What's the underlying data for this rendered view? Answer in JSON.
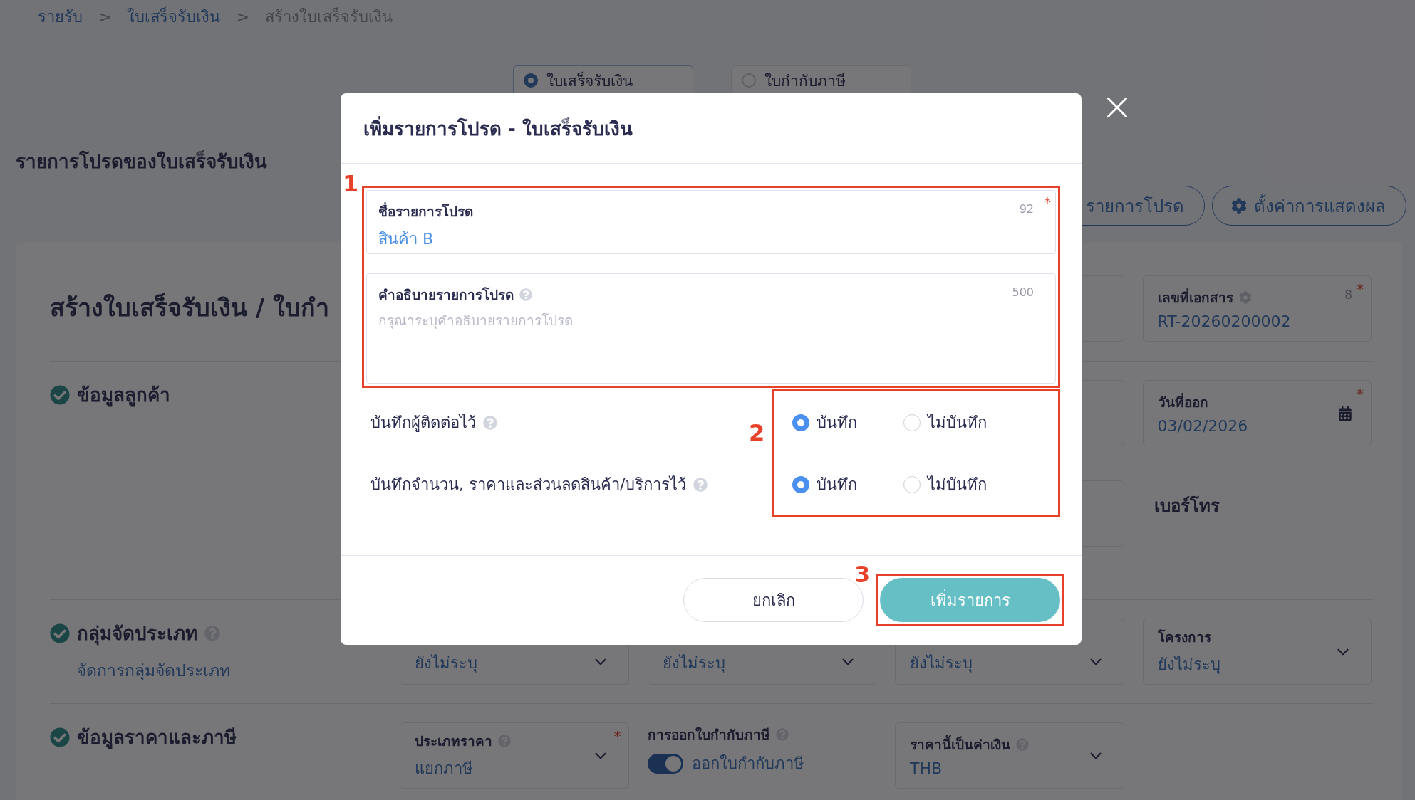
{
  "breadcrumb": [
    {
      "label": "รายรับ",
      "current": false
    },
    {
      "separator": ">",
      "label": "ใบเสร็จรับเงิน",
      "current": false
    },
    {
      "separator": ">",
      "label": "สร้างใบเสร็จรับเงิน",
      "current": true
    }
  ],
  "document_tabs": [
    {
      "label": "ใบเสร็จรับเงิน",
      "selected": true
    },
    {
      "label": "ใบกำกับภาษี",
      "selected": false
    }
  ],
  "favorites_title": "รายการโปรดของใบเสร็จรับเงิน",
  "toolbar_buttons": [
    {
      "kind": "plain",
      "label": "รายการโปรด"
    },
    {
      "kind": "gear",
      "label": "ตั้งค่าการแสดงผล"
    }
  ],
  "form": {
    "title": "สร้างใบเสร็จรับเงิน / ใบกำ",
    "header_fields": [
      {
        "kind": "blank"
      },
      {
        "kind": "text",
        "label": "เลขที่เอกสาร",
        "settings_icon": true,
        "counter": "8",
        "required": "*",
        "value": "RT-20260200002"
      }
    ],
    "sections": [
      {
        "title": "ข้อมูลลูกค้า",
        "done": true,
        "fields": [
          {
            "kind": "blank"
          },
          {
            "kind": "blank"
          },
          {
            "kind": "blank"
          },
          {
            "kind": "date",
            "label": "วันที่ออก",
            "required": "*",
            "value": "03/02/2026"
          },
          {
            "kind": "blank"
          },
          {
            "kind": "blank"
          },
          {
            "kind": "blank"
          },
          {
            "kind": "heading",
            "label": "เบอร์โทร"
          }
        ]
      },
      {
        "title": "กลุ่มจัดประเภท",
        "done": true,
        "help": true,
        "link": "จัดการกลุ่มจัดประเภท",
        "fields": [
          {
            "kind": "select",
            "value": "ยังไม่ระบุ"
          },
          {
            "kind": "select",
            "value": "ยังไม่ระบุ"
          },
          {
            "kind": "select",
            "value": "ยังไม่ระบุ"
          },
          {
            "kind": "select",
            "label": "โครงการ",
            "value": "ยังไม่ระบุ"
          }
        ]
      },
      {
        "title": "ข้อมูลราคาและภาษี",
        "done": true,
        "fields": [
          {
            "kind": "select",
            "label": "ประเภทราคา",
            "help": true,
            "required": "*",
            "value": "แยกภาษี"
          },
          {
            "kind": "toggle",
            "label": "การออกใบกำกับภาษี",
            "help": true,
            "on": true,
            "value": "ออกใบกำกับภาษี"
          },
          {
            "kind": "select",
            "label": "ราคานี้เป็นค่าเงิน",
            "help": true,
            "value": "THB"
          }
        ]
      }
    ]
  },
  "modal": {
    "title": "เพิ่มรายการโปรด - ใบเสร็จรับเงิน",
    "text_fields": [
      {
        "kind": "input",
        "label": "ชื่อรายการโปรด",
        "counter": "92",
        "required": "*",
        "value": "สินค้า B"
      },
      {
        "kind": "textarea",
        "label": "คำอธิบายรายการโปรด",
        "help": true,
        "counter": "500",
        "placeholder": "กรุณาระบุคำอธิบายรายการโปรด"
      }
    ],
    "options": [
      {
        "label": "บันทึกผู้ติดต่อไว้",
        "help": true,
        "choices": [
          {
            "label": "บันทึก",
            "selected": true
          },
          {
            "label": "ไม่บันทึก",
            "selected": false
          }
        ]
      },
      {
        "label": "บันทึกจำนวน, ราคาและส่วนลดสินค้า/บริการไว้",
        "help": true,
        "choices": [
          {
            "label": "บันทึก",
            "selected": true
          },
          {
            "label": "ไม่บันทึก",
            "selected": false
          }
        ]
      }
    ],
    "buttons": [
      {
        "kind": "secondary",
        "label": "ยกเลิก"
      },
      {
        "kind": "primary",
        "label": "เพิ่มรายการ"
      }
    ],
    "annotations": [
      {
        "number": "1"
      },
      {
        "number": "2"
      },
      {
        "number": "3"
      }
    ]
  }
}
